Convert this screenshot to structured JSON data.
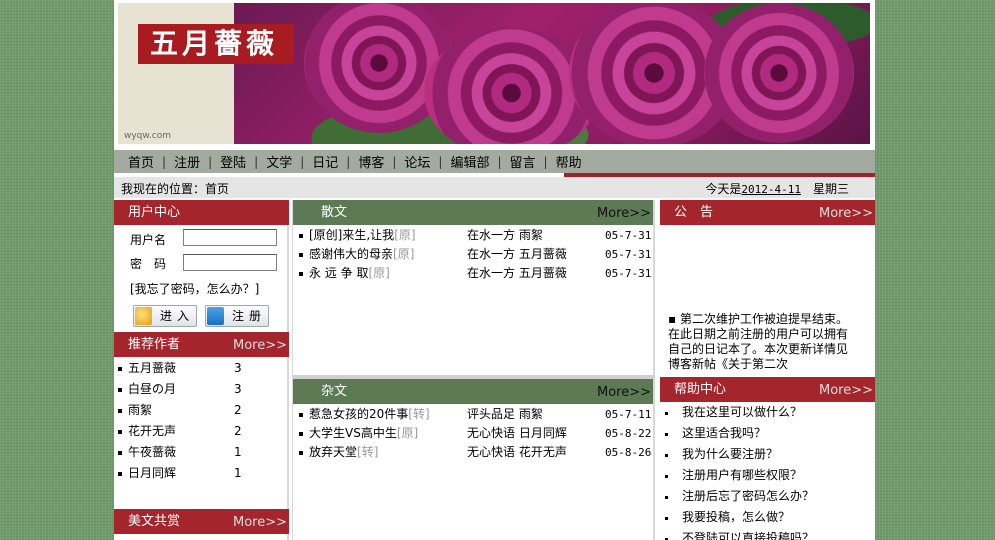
{
  "banner": {
    "logo_text": "五月薔薇",
    "url_text": "wyqw.com"
  },
  "nav": [
    "首页",
    "注册",
    "登陆",
    "文学",
    "日记",
    "博客",
    "论坛",
    "编辑部",
    "留言",
    "帮助"
  ],
  "location": {
    "label": "我现在的位置：首页",
    "today_prefix": "今天是",
    "date": "2012-4-11",
    "weekday": "星期三"
  },
  "user_center": {
    "title": "用户中心",
    "username_label": "用户名",
    "password_label": "密　码",
    "forgot_text": "[我忘了密码，怎么办？]",
    "login_btn": "进入",
    "register_btn": "注册"
  },
  "recommended": {
    "title": "推荐作者",
    "more": "More>>",
    "authors": [
      {
        "name": "五月蔷薇",
        "count": "3"
      },
      {
        "name": "白昼の月",
        "count": "3"
      },
      {
        "name": "雨絮",
        "count": "2"
      },
      {
        "name": "花开无声",
        "count": "2"
      },
      {
        "name": "午夜蔷薇",
        "count": "1"
      },
      {
        "name": "日月同辉",
        "count": "1"
      }
    ]
  },
  "appreciation": {
    "title": "美文共赏",
    "more": "More>>"
  },
  "prose": {
    "title": "散文",
    "more": "More>>",
    "items": [
      {
        "title": "[原创]来生,让我",
        "tag": "[原]",
        "column": "在水一方",
        "author": "雨絮",
        "date": "05-7-31"
      },
      {
        "title": "感谢伟大的母亲",
        "tag": "[原]",
        "column": "在水一方",
        "author": "五月蔷薇",
        "date": "05-7-31"
      },
      {
        "title": "永 远 争 取",
        "tag": "[原]",
        "column": "在水一方",
        "author": "五月蔷薇",
        "date": "05-7-31"
      }
    ]
  },
  "misc": {
    "title": "杂文",
    "more": "More>>",
    "items": [
      {
        "title": "惹急女孩的20件事",
        "tag": "[转]",
        "column": "评头品足",
        "author": "雨絮",
        "date": "05-7-11"
      },
      {
        "title": "大学生VS高中生",
        "tag": "[原]",
        "column": "无心快语",
        "author": "日月同辉",
        "date": "05-8-22"
      },
      {
        "title": "放弃天堂",
        "tag": "[转]",
        "column": "无心快语",
        "author": "花开无声",
        "date": "05-8-26"
      }
    ]
  },
  "announcement": {
    "title": "公　告",
    "more": "More>>",
    "text": "▪ 第二次维护工作被迫提早结束。在此日期之前注册的用户可以拥有自己的日记本了。本次更新详情见博客新帖《关于第二次"
  },
  "help": {
    "title": "帮助中心",
    "more": "More>>",
    "items": [
      "我在这里可以做什么？",
      "这里适合我吗？",
      "我为什么要注册？",
      "注册用户有哪些权限？",
      "注册后忘了密码怎么办？",
      "我要投稿，怎么做？",
      "不登陆可以直接投稿吗？"
    ]
  },
  "colors": {
    "red": "#a4262c",
    "green": "#5c7b55",
    "nav_bg": "#a3aba0"
  }
}
